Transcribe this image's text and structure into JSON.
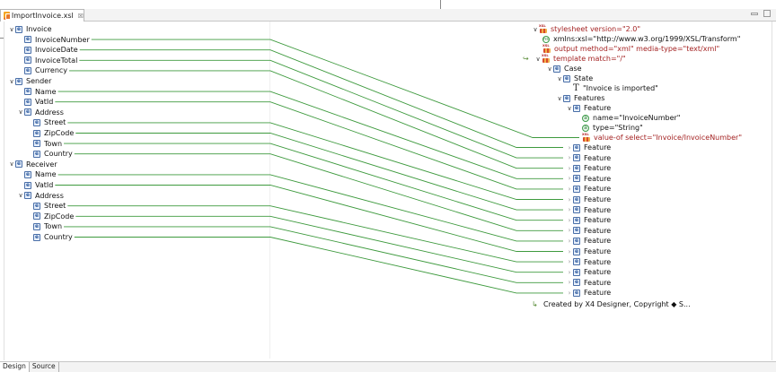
{
  "editor_tab": {
    "label": "ImportInvoice.xsl",
    "close": "☒"
  },
  "source_tree": {
    "nodes": [
      {
        "label": "Invoice",
        "depth": 0,
        "expanded": true,
        "mapped": false
      },
      {
        "label": "InvoiceNumber",
        "depth": 1,
        "mapped": true
      },
      {
        "label": "InvoiceDate",
        "depth": 1,
        "mapped": true
      },
      {
        "label": "InvoiceTotal",
        "depth": 1,
        "mapped": true
      },
      {
        "label": "Currency",
        "depth": 1,
        "mapped": true
      },
      {
        "label": "Sender",
        "depth": 0,
        "expanded": true,
        "mapped": false
      },
      {
        "label": "Name",
        "depth": 1,
        "mapped": true
      },
      {
        "label": "VatId",
        "depth": 1,
        "mapped": true
      },
      {
        "label": "Address",
        "depth": 1,
        "expanded": true,
        "mapped": false
      },
      {
        "label": "Street",
        "depth": 2,
        "mapped": true
      },
      {
        "label": "ZipCode",
        "depth": 2,
        "mapped": true
      },
      {
        "label": "Town",
        "depth": 2,
        "mapped": true
      },
      {
        "label": "Country",
        "depth": 2,
        "mapped": true
      },
      {
        "label": "Receiver",
        "depth": 0,
        "expanded": true,
        "mapped": false
      },
      {
        "label": "Name",
        "depth": 1,
        "mapped": true
      },
      {
        "label": "VatId",
        "depth": 1,
        "mapped": true
      },
      {
        "label": "Address",
        "depth": 1,
        "expanded": true,
        "mapped": false
      },
      {
        "label": "Street",
        "depth": 2,
        "mapped": true
      },
      {
        "label": "ZipCode",
        "depth": 2,
        "mapped": true
      },
      {
        "label": "Town",
        "depth": 2,
        "mapped": true
      },
      {
        "label": "Country",
        "depth": 2,
        "mapped": true
      }
    ]
  },
  "target_tree": {
    "stylesheet": "stylesheet version=\"2.0\"",
    "namespace": "xmlns:xsl=\"http://www.w3.org/1999/XSL/Transform\"",
    "output": "output method=\"xml\" media-type=\"text/xml\"",
    "template": "template match=\"/\"",
    "case": "Case",
    "state": "State",
    "state_text": "\"Invoice is imported\"",
    "features": "Features",
    "feature_open": "Feature",
    "attr_name": "name=\"InvoiceNumber\"",
    "attr_type": "type=\"String\"",
    "value_of": "value-of select=\"Invoice/InvoiceNumber\"",
    "feature_label": "Feature",
    "feature_count": 15,
    "copyright": "Created by X4 Designer, Copyright ◆ S..."
  },
  "bottom_tabs": {
    "design": "Design",
    "source": "Source",
    "active": "design"
  },
  "colors": {
    "mapping_line": "#3e9a3e",
    "xsl_text": "#a42323",
    "element_icon": "#2d5a9e"
  },
  "icons": {
    "editor": "xsl-file-icon",
    "element": "element-icon",
    "attribute": "attribute-icon",
    "namespace": "namespace-icon",
    "text": "text-node-icon"
  }
}
